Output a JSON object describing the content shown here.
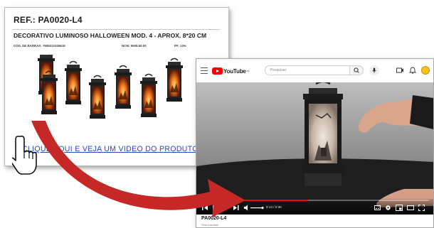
{
  "catalog": {
    "ref": "REF.: PA0020-L4",
    "product_name": "DECORATIVO LUMINOSO HALLOWEEN MOD. 4 - APROX. 8*20 CM",
    "barcode": "CÓD. DE BARRAS: 7908221039616",
    "ncm": "NCM: 9505.90.00",
    "ipi": "IPI: 13%",
    "lantern_count": 6,
    "video_link": "CLIQUE AQUI E VEJA UM VIDEO DO PRODUTO"
  },
  "youtube": {
    "logo_text": "YouTube",
    "logo_region": "BR",
    "search_placeholder": "Pesquisar",
    "time_display": "0:14 / 0:30",
    "progress": 0.47,
    "video_title": "PA0020-L4",
    "channel_line": "Sem inscritos"
  },
  "colors": {
    "arrow": "#c62828",
    "link": "#1f4fbf",
    "youtube_red": "#ff0000"
  },
  "icons": [
    "menu-icon",
    "search-icon",
    "mic-icon",
    "create-icon",
    "bell-icon",
    "avatar",
    "hand-cursor-icon",
    "play-icon",
    "next-icon",
    "volume-icon",
    "settings-icon",
    "fullscreen-icon"
  ]
}
